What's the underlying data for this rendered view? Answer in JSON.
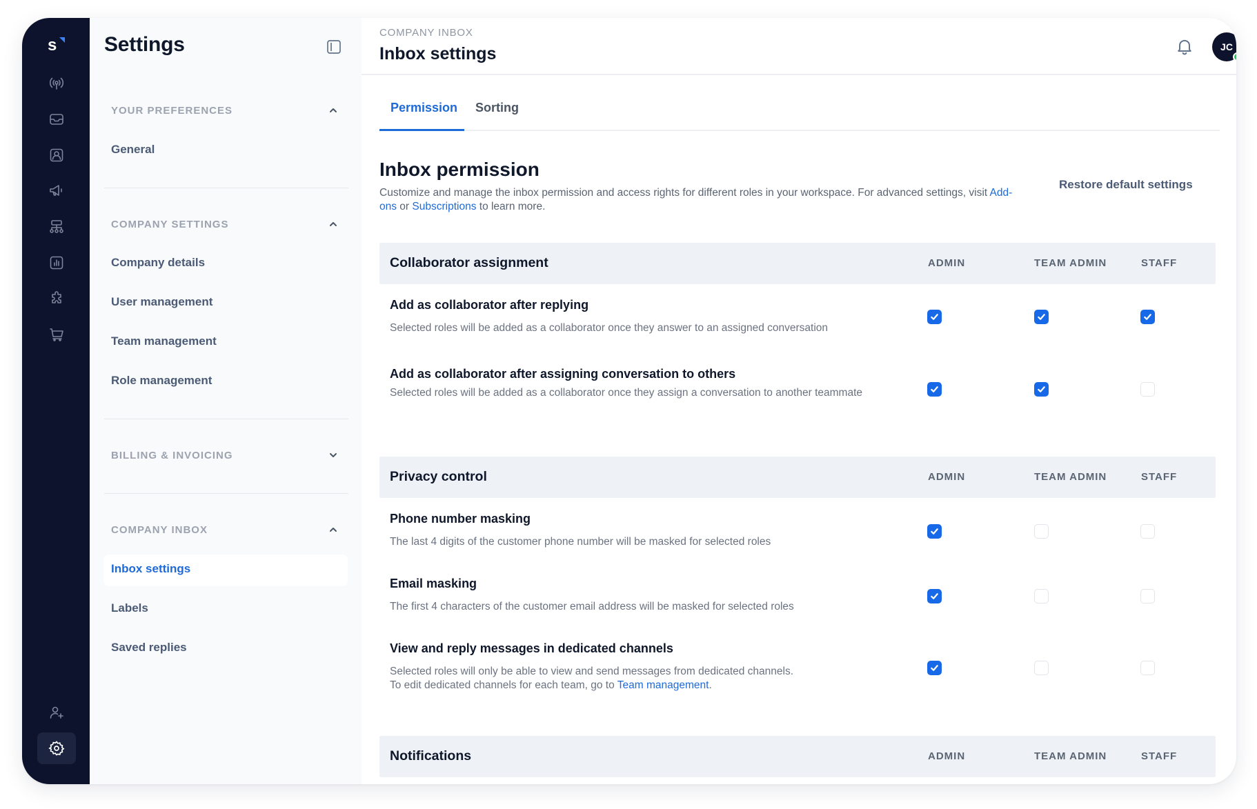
{
  "app": {
    "logo_letter": "s",
    "rail_icons": [
      "broadcast-icon",
      "inbox-icon",
      "contacts-icon",
      "megaphone-icon",
      "workflow-icon",
      "reports-icon",
      "integrations-icon",
      "commerce-icon"
    ],
    "rail_bottom_icons": [
      "invite-user-icon",
      "settings-icon"
    ]
  },
  "settings": {
    "title": "Settings",
    "groups": [
      {
        "label": "YOUR PREFERENCES",
        "expanded": true,
        "items": [
          {
            "label": "General"
          }
        ]
      },
      {
        "label": "COMPANY SETTINGS",
        "expanded": true,
        "items": [
          {
            "label": "Company details"
          },
          {
            "label": "User management"
          },
          {
            "label": "Team management"
          },
          {
            "label": "Role management"
          }
        ]
      },
      {
        "label": "BILLING & INVOICING",
        "expanded": false,
        "items": []
      },
      {
        "label": "COMPANY INBOX",
        "expanded": true,
        "items": [
          {
            "label": "Inbox settings",
            "active": true
          },
          {
            "label": "Labels"
          },
          {
            "label": "Saved replies"
          }
        ]
      }
    ]
  },
  "header": {
    "breadcrumb": "COMPANY INBOX",
    "title": "Inbox settings",
    "avatar_initials": "JC",
    "avatar_status": "online"
  },
  "tabs": [
    {
      "label": "Permission",
      "active": true
    },
    {
      "label": "Sorting",
      "active": false
    }
  ],
  "permission": {
    "title": "Inbox permission",
    "desc_prefix": "Customize and manage the inbox permission and access rights for different roles in your workspace. For advanced settings, visit ",
    "link_addons": "Add-ons",
    "desc_or": " or ",
    "link_subscriptions": "Subscriptions",
    "desc_suffix": " to learn more.",
    "restore_label": "Restore default settings",
    "columns": [
      "ADMIN",
      "TEAM ADMIN",
      "STAFF"
    ],
    "sections": [
      {
        "title": "Collaborator assignment",
        "rows": [
          {
            "title": "Add as collaborator after replying",
            "desc": "Selected roles will be added as a collaborator once they answer to an assigned conversation",
            "values": [
              true,
              true,
              true
            ]
          },
          {
            "title": "Add as collaborator after assigning conversation to others",
            "desc": "Selected roles will be added as a collaborator once they assign a conversation to another teammate",
            "values": [
              true,
              true,
              false
            ]
          }
        ]
      },
      {
        "title": "Privacy control",
        "rows": [
          {
            "title": "Phone number masking",
            "desc": "The last 4 digits of the customer phone number will be masked for selected roles",
            "values": [
              true,
              false,
              false
            ]
          },
          {
            "title": "Email masking",
            "desc": "The first 4 characters of the customer email address will be masked for selected roles",
            "values": [
              true,
              false,
              false
            ]
          },
          {
            "title": "View and reply messages in dedicated channels",
            "desc": "Selected roles will only be able to view and send messages from dedicated channels.",
            "desc_line2_prefix": "To edit dedicated channels for each team, go to ",
            "desc_link": "Team management",
            "desc_line2_suffix": ".",
            "values": [
              true,
              false,
              false
            ]
          }
        ]
      },
      {
        "title": "Notifications",
        "rows": []
      }
    ]
  },
  "colors": {
    "rail_bg": "#0d132d",
    "accent": "#1d6ad8",
    "checkbox_checked": "#1769e8",
    "status_online": "#22c55e",
    "section_bar_bg": "#eef2f7"
  }
}
